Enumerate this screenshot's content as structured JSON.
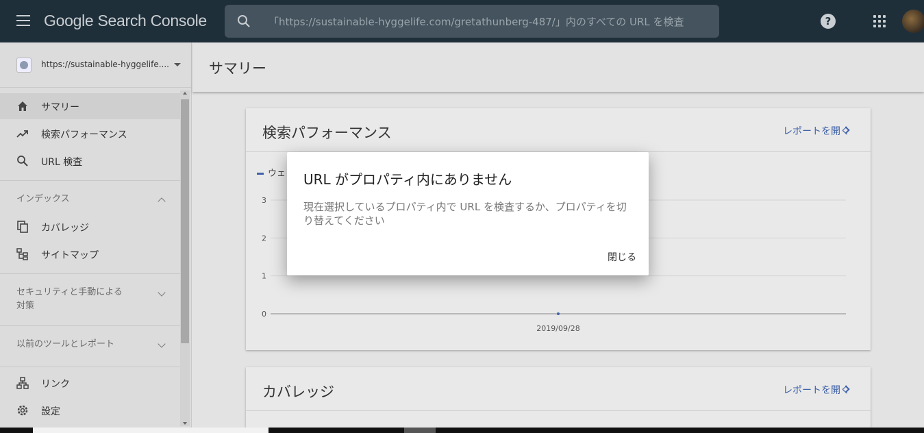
{
  "app": {
    "brand": "Google Search Console",
    "search_placeholder": "「https://sustainable-hyggelife.com/gretathunberg-487/」内のすべての URL を検査",
    "help_glyph": "?"
  },
  "sidebar": {
    "property": "https://sustainable-hyggelife....",
    "items_top": [
      {
        "label": "サマリー",
        "icon": "home-icon"
      },
      {
        "label": "検索パフォーマンス",
        "icon": "trending-up-icon"
      },
      {
        "label": "URL 検査",
        "icon": "search-icon"
      }
    ],
    "index_section": "インデックス",
    "index_items": [
      {
        "label": "カバレッジ",
        "icon": "copy-icon"
      },
      {
        "label": "サイトマップ",
        "icon": "sitemap-icon"
      }
    ],
    "security_section_line1": "セキュリティと手動による",
    "security_section_line2": "対策",
    "legacy_section": "以前のツールとレポート",
    "bottom_items": [
      {
        "label": "リンク",
        "icon": "links-icon"
      },
      {
        "label": "設定",
        "icon": "gear-icon"
      }
    ]
  },
  "main": {
    "page_title": "サマリー",
    "performance_card": {
      "title": "検索パフォーマンス",
      "link": "レポートを開く",
      "legend_partial": "ウェ"
    },
    "coverage_card": {
      "title": "カバレッジ",
      "link": "レポートを開く"
    }
  },
  "chart_data": {
    "type": "line",
    "x": [
      "2019/09/28"
    ],
    "series": [
      {
        "values": [
          0
        ]
      }
    ],
    "yticks": [
      "3",
      "2",
      "1",
      "0"
    ],
    "ylim": [
      0,
      3
    ],
    "grid": true
  },
  "dialog": {
    "title": "URL がプロパティ内にありません",
    "body": "現在選択しているプロパティ内で URL を検査するか、プロパティを切り替えてください",
    "close_label": "閉じる"
  },
  "colors": {
    "topbar": "#1f2f3a",
    "link": "#3f62a8",
    "series": "#3f62a8"
  }
}
